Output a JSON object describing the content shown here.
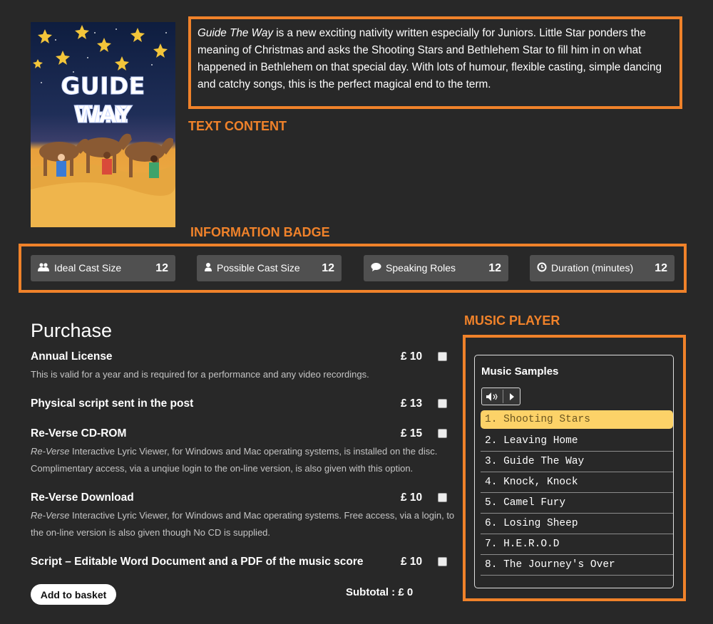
{
  "cover": {
    "title_line1": "GUIDE THE",
    "title_line2": "WAY"
  },
  "description": {
    "title": "Guide The Way",
    "text": " is a new exciting nativity written especially for Juniors. Little Star ponders the meaning of Christmas and asks the Shooting Stars and Bethlehem Star to fill him in on what happened in Bethlehem on that special day.  With lots of humour, flexible casting, simple dancing and catchy songs, this is the perfect magical end to the term."
  },
  "annotations": {
    "text_content": "TEXT CONTENT",
    "information_badge": "INFORMATION BADGE",
    "music_player": "MUSIC PLAYER"
  },
  "badges": [
    {
      "icon": "users-icon",
      "label": "Ideal Cast Size",
      "value": "12"
    },
    {
      "icon": "user-icon",
      "label": "Possible Cast Size",
      "value": "12"
    },
    {
      "icon": "speech-bubble-icon",
      "label": "Speaking Roles",
      "value": "12"
    },
    {
      "icon": "clock-icon",
      "label": "Duration (minutes)",
      "value": "12"
    }
  ],
  "purchase": {
    "title": "Purchase",
    "items": [
      {
        "name": "Annual License",
        "price": "£ 10",
        "desc_em": "",
        "desc": "This is valid for a year and is required for a performance and any video recordings."
      },
      {
        "name": "Physical script sent in the post",
        "price": "£ 13",
        "desc_em": "",
        "desc": ""
      },
      {
        "name": "Re-Verse CD-ROM",
        "price": "£ 15",
        "desc_em": "Re-Verse",
        "desc": " Interactive Lyric Viewer, for Windows and Mac operating systems, is installed on the disc. Complimentary access, via a unqiue login to the on-line version, is also given with this option."
      },
      {
        "name": "Re-Verse Download",
        "price": "£ 10",
        "desc_em": "Re-Verse",
        "desc": " Interactive Lyric Viewer, for Windows and Mac operating systems. Free access, via a login, to the on-line version is also given though No CD is supplied."
      },
      {
        "name": "Script – Editable Word Document and a PDF of the music score",
        "price": "£ 10",
        "desc_em": "",
        "desc": ""
      }
    ],
    "button": "Add to basket",
    "subtotal": "Subtotal : £ 0"
  },
  "player": {
    "title": "Music Samples",
    "tracks": [
      "1. Shooting Stars",
      "2. Leaving Home",
      "3. Guide The Way",
      "4. Knock, Knock",
      "5. Camel Fury",
      "6. Losing Sheep",
      "7. H.E.R.O.D",
      "8. The Journey's Over"
    ]
  },
  "colors": {
    "accent": "#f0822a",
    "background": "#282828",
    "active_track": "#fcd268",
    "badge": "#505050"
  }
}
